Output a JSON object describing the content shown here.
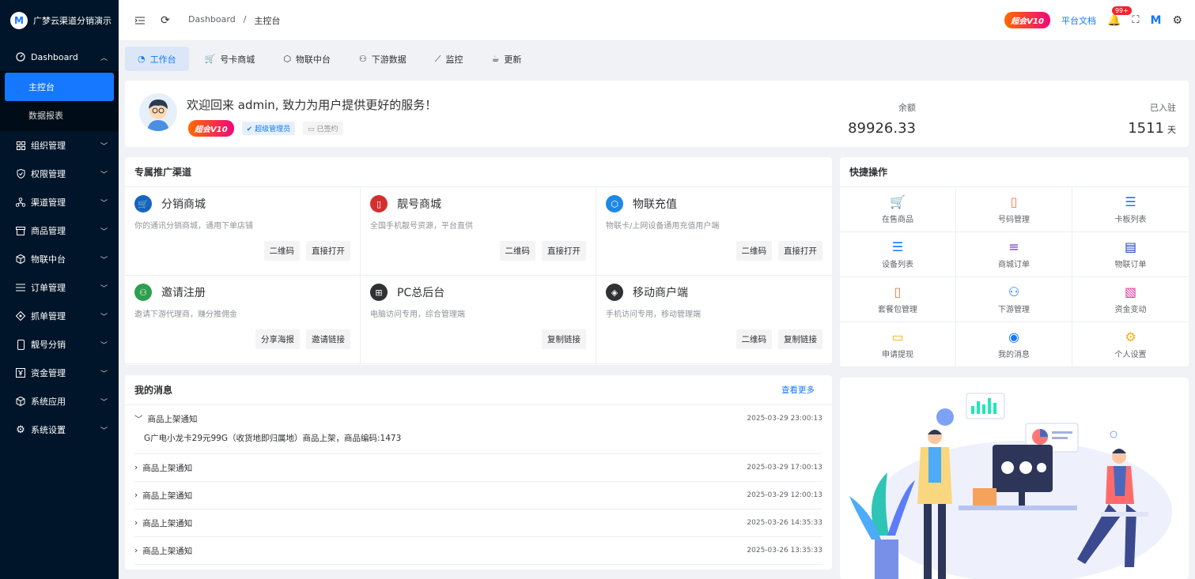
{
  "app": {
    "name": "广梦云渠道分销演示"
  },
  "sidebar": {
    "items": [
      {
        "label": "Dashboard",
        "icon": "dashboard-icon",
        "expanded": true
      },
      {
        "label": "组织管理",
        "icon": "grid-icon"
      },
      {
        "label": "权限管理",
        "icon": "shield-icon"
      },
      {
        "label": "渠道管理",
        "icon": "network-icon"
      },
      {
        "label": "商品管理",
        "icon": "store-icon"
      },
      {
        "label": "物联中台",
        "icon": "cube-icon"
      },
      {
        "label": "订单管理",
        "icon": "list-icon"
      },
      {
        "label": "抓单管理",
        "icon": "diamond-icon"
      },
      {
        "label": "靓号分销",
        "icon": "phone-icon"
      },
      {
        "label": "资金管理",
        "icon": "money-icon"
      },
      {
        "label": "系统应用",
        "icon": "package-icon"
      },
      {
        "label": "系统设置",
        "icon": "gear-icon"
      }
    ],
    "sub": [
      "主控台",
      "数据报表"
    ]
  },
  "header": {
    "breadcrumb": [
      "Dashboard",
      "/",
      "主控台"
    ],
    "version_badge": "超会V10",
    "docs_link": "平台文档",
    "notify_count": "99+"
  },
  "tabs": [
    {
      "label": "工作台",
      "icon": "dashboard-icon"
    },
    {
      "label": "号卡商城",
      "icon": "cart-icon"
    },
    {
      "label": "物联中台",
      "icon": "cube-icon"
    },
    {
      "label": "下游数据",
      "icon": "user-icon"
    },
    {
      "label": "监控",
      "icon": "chart-line-icon"
    },
    {
      "label": "更新",
      "icon": "coffee-icon"
    }
  ],
  "welcome": {
    "title": "欢迎回来 admin, 致力为用户提供更好的服务！",
    "badge_vip": "超会V10",
    "badge_admin": "超级管理员",
    "badge_sign": "已签约",
    "balance_label": "余额",
    "balance_value": "89926.33",
    "days_label": "已入驻",
    "days_value": "1511",
    "days_unit": "天"
  },
  "channels": {
    "title": "专属推广渠道",
    "items": [
      {
        "title": "分销商城",
        "desc": "你的通讯分销商城，通用下单店铺",
        "color": "#1565c0",
        "icon": "cart-icon",
        "buttons": [
          "二维码",
          "直接打开"
        ]
      },
      {
        "title": "靓号商城",
        "desc": "全国手机靓号资源，平台直供",
        "color": "#d32f2f",
        "icon": "phone-icon",
        "buttons": [
          "二维码",
          "直接打开"
        ]
      },
      {
        "title": "物联充值",
        "desc": "物联卡/上网设备通用充值用户端",
        "color": "#1e88e5",
        "icon": "cube-icon",
        "buttons": [
          "二维码",
          "直接打开"
        ]
      },
      {
        "title": "邀请注册",
        "desc": "邀请下游代理商，赚分推佣金",
        "color": "#2e9e4f",
        "icon": "user-add-icon",
        "buttons": [
          "分享海报",
          "邀请链接"
        ]
      },
      {
        "title": "PC总后台",
        "desc": "电脑访问专用，综合管理端",
        "color": "#303133",
        "icon": "windows-icon",
        "buttons": [
          "复制链接"
        ]
      },
      {
        "title": "移动商户端",
        "desc": "手机访问专用，移动管理端",
        "color": "#303133",
        "icon": "compass-icon",
        "buttons": [
          "二维码",
          "复制链接"
        ]
      }
    ]
  },
  "quick": {
    "title": "快捷操作",
    "items": [
      {
        "label": "在售商品",
        "icon": "cart-icon",
        "color": "#1677ff",
        "glyph": "🛒"
      },
      {
        "label": "号码管理",
        "icon": "phone-icon",
        "color": "#ff7a45",
        "glyph": "▯"
      },
      {
        "label": "卡板列表",
        "icon": "list-circle-icon",
        "color": "#1677ff",
        "glyph": "☰"
      },
      {
        "label": "设备列表",
        "icon": "list-circle-icon",
        "color": "#1677ff",
        "glyph": "☰"
      },
      {
        "label": "商城订单",
        "icon": "menu-icon",
        "color": "#722ed1",
        "glyph": "≡"
      },
      {
        "label": "物联订单",
        "icon": "document-icon",
        "color": "#1d39c4",
        "glyph": "▤"
      },
      {
        "label": "套餐包管理",
        "icon": "phone-icon",
        "color": "#ff7a45",
        "glyph": "▯"
      },
      {
        "label": "下游管理",
        "icon": "users-icon",
        "color": "#1677ff",
        "glyph": "⚇"
      },
      {
        "label": "资金变动",
        "icon": "file-icon",
        "color": "#eb2f96",
        "glyph": "▧"
      },
      {
        "label": "申请提现",
        "icon": "card-icon",
        "color": "#faad14",
        "glyph": "▭"
      },
      {
        "label": "我的消息",
        "icon": "bell-icon",
        "color": "#1677ff",
        "glyph": "◉"
      },
      {
        "label": "个人设置",
        "icon": "gear-icon",
        "color": "#faad14",
        "glyph": "⚙"
      }
    ]
  },
  "messages": {
    "title": "我的消息",
    "more": "查看更多",
    "items": [
      {
        "title": "商品上架通知",
        "date": "2025-03-29 23:00:13",
        "expanded": true,
        "body": "G广电小龙卡29元99G（收货地即归属地）商品上架，商品编码:1473"
      },
      {
        "title": "商品上架通知",
        "date": "2025-03-29 17:00:13"
      },
      {
        "title": "商品上架通知",
        "date": "2025-03-29 12:00:13"
      },
      {
        "title": "商品上架通知",
        "date": "2025-03-26 14:35:33"
      },
      {
        "title": "商品上架通知",
        "date": "2025-03-26 13:35:33"
      }
    ]
  }
}
